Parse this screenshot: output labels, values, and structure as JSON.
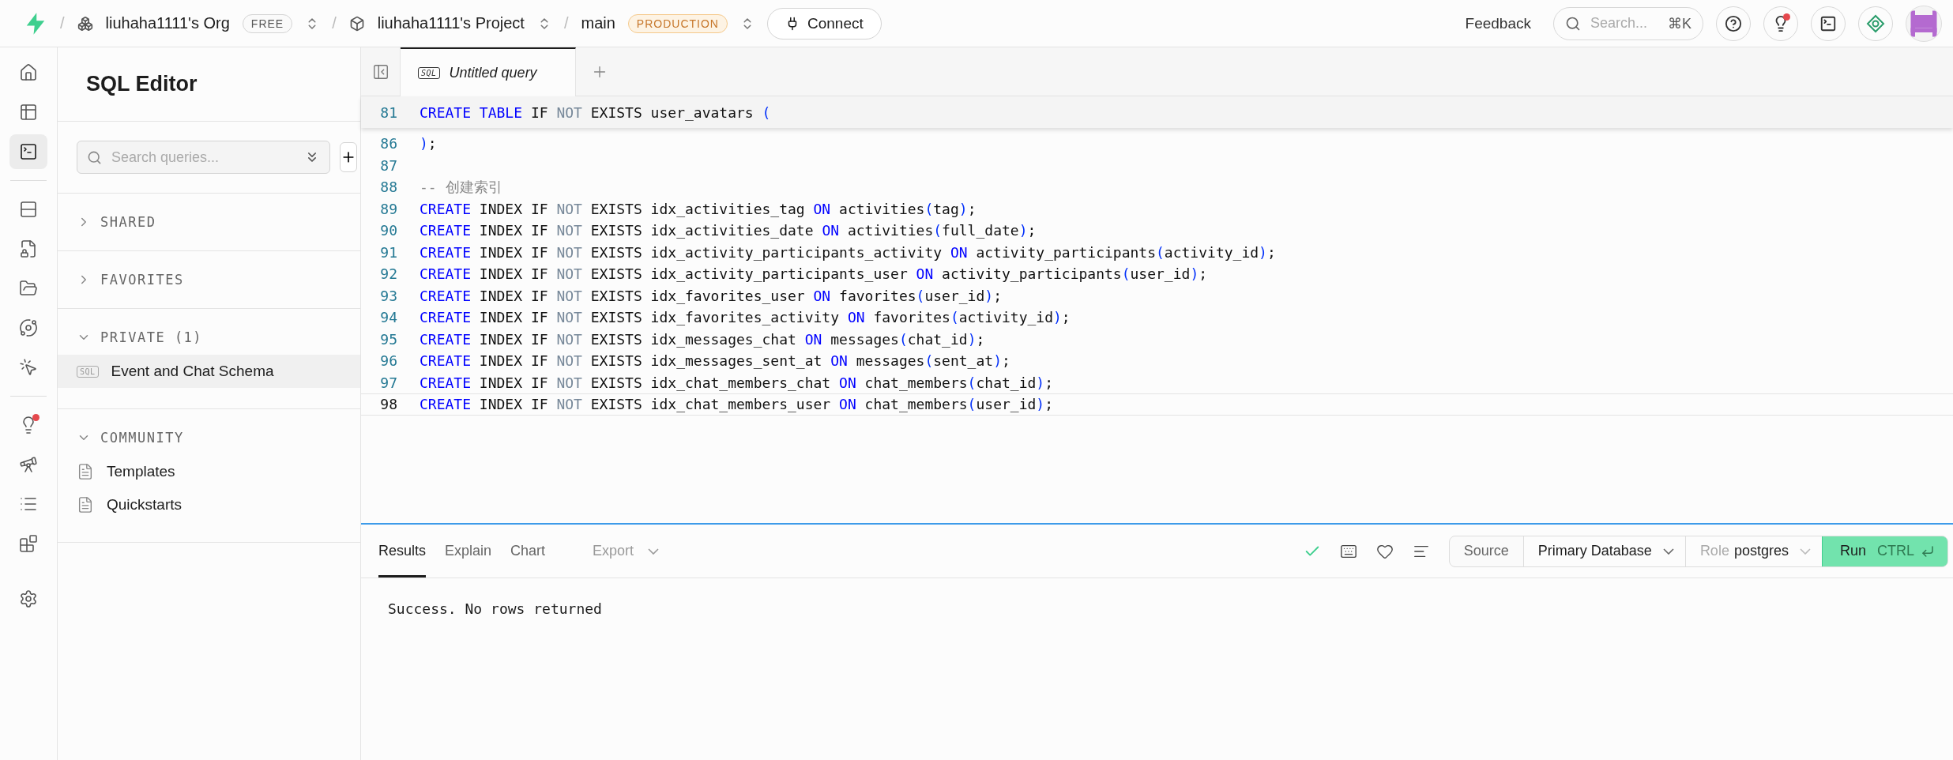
{
  "topbar": {
    "separators": [
      "/",
      "/",
      "/"
    ],
    "org": "liuhaha1111's Org",
    "org_plan": "FREE",
    "project": "liuhaha1111's Project",
    "branch": "main",
    "branch_env": "PRODUCTION",
    "connect": "Connect",
    "feedback": "Feedback",
    "search": {
      "placeholder": "Search...",
      "shortcut": "⌘K"
    },
    "tips_dot": true
  },
  "rail": [
    {
      "selected": false,
      "dot": false
    },
    {
      "selected": false,
      "dot": false
    },
    {
      "selected": true,
      "dot": false
    },
    {
      "selected": false,
      "dot": false
    },
    {
      "selected": false,
      "dot": false
    },
    {
      "selected": false,
      "dot": false
    },
    {
      "selected": false,
      "dot": false
    },
    {
      "selected": false,
      "dot": false
    },
    {
      "selected": false,
      "dot": true
    },
    {
      "selected": false,
      "dot": false
    },
    {
      "selected": false,
      "dot": false
    },
    {
      "selected": false,
      "dot": false
    },
    {
      "selected": false,
      "dot": false
    }
  ],
  "sidebar": {
    "title": "SQL Editor",
    "search": {
      "placeholder": "Search queries..."
    },
    "sections": [
      {
        "label": "SHARED",
        "expanded": false
      },
      {
        "label": "FAVORITES",
        "expanded": false
      },
      {
        "label": "PRIVATE (1)",
        "expanded": true,
        "items": [
          {
            "kind": "query",
            "badge": "SQL",
            "label": "Event and Chat Schema",
            "selected": true
          }
        ]
      },
      {
        "label": "COMMUNITY",
        "expanded": true,
        "items": [
          {
            "kind": "doc",
            "label": "Templates",
            "selected": false
          },
          {
            "kind": "doc",
            "label": "Quickstarts",
            "selected": false
          }
        ]
      }
    ]
  },
  "editor": {
    "tabs": [
      {
        "badge": "SQL",
        "label": "Untitled query",
        "selected": true
      }
    ],
    "sticky_line": {
      "number": "81",
      "tokens": [
        {
          "kind": "keyword",
          "text": "CREATE TABLE "
        },
        {
          "kind": "plain",
          "text": "IF "
        },
        {
          "kind": "muted",
          "text": "NOT "
        },
        {
          "kind": "plain",
          "text": "EXISTS user_avatars "
        },
        {
          "kind": "bracket",
          "text": "("
        }
      ]
    },
    "lines": [
      {
        "number": "86",
        "current": false,
        "tokens": [
          {
            "kind": "bracket",
            "text": ")"
          },
          {
            "kind": "plain",
            "text": ";"
          }
        ]
      },
      {
        "number": "87",
        "current": false
      },
      {
        "number": "88",
        "current": false,
        "tokens": [
          {
            "kind": "comment",
            "text": "-- 创建索引"
          }
        ]
      },
      {
        "number": "89",
        "current": false,
        "tokens": [
          {
            "kind": "keyword",
            "text": "CREATE "
          },
          {
            "kind": "plain",
            "text": "INDEX IF "
          },
          {
            "kind": "muted",
            "text": "NOT "
          },
          {
            "kind": "plain",
            "text": "EXISTS idx_activities_tag "
          },
          {
            "kind": "keyword",
            "text": "ON "
          },
          {
            "kind": "plain",
            "text": "activities"
          },
          {
            "kind": "bracket",
            "text": "("
          },
          {
            "kind": "plain",
            "text": "tag"
          },
          {
            "kind": "bracket",
            "text": ")"
          },
          {
            "kind": "plain",
            "text": ";"
          }
        ]
      },
      {
        "number": "90",
        "current": false,
        "tokens": [
          {
            "kind": "keyword",
            "text": "CREATE "
          },
          {
            "kind": "plain",
            "text": "INDEX IF "
          },
          {
            "kind": "muted",
            "text": "NOT "
          },
          {
            "kind": "plain",
            "text": "EXISTS idx_activities_date "
          },
          {
            "kind": "keyword",
            "text": "ON "
          },
          {
            "kind": "plain",
            "text": "activities"
          },
          {
            "kind": "bracket",
            "text": "("
          },
          {
            "kind": "plain",
            "text": "full_date"
          },
          {
            "kind": "bracket",
            "text": ")"
          },
          {
            "kind": "plain",
            "text": ";"
          }
        ]
      },
      {
        "number": "91",
        "current": false,
        "tokens": [
          {
            "kind": "keyword",
            "text": "CREATE "
          },
          {
            "kind": "plain",
            "text": "INDEX IF "
          },
          {
            "kind": "muted",
            "text": "NOT "
          },
          {
            "kind": "plain",
            "text": "EXISTS idx_activity_participants_activity "
          },
          {
            "kind": "keyword",
            "text": "ON "
          },
          {
            "kind": "plain",
            "text": "activity_participants"
          },
          {
            "kind": "bracket",
            "text": "("
          },
          {
            "kind": "plain",
            "text": "activity_id"
          },
          {
            "kind": "bracket",
            "text": ")"
          },
          {
            "kind": "plain",
            "text": ";"
          }
        ]
      },
      {
        "number": "92",
        "current": false,
        "tokens": [
          {
            "kind": "keyword",
            "text": "CREATE "
          },
          {
            "kind": "plain",
            "text": "INDEX IF "
          },
          {
            "kind": "muted",
            "text": "NOT "
          },
          {
            "kind": "plain",
            "text": "EXISTS idx_activity_participants_user "
          },
          {
            "kind": "keyword",
            "text": "ON "
          },
          {
            "kind": "plain",
            "text": "activity_participants"
          },
          {
            "kind": "bracket",
            "text": "("
          },
          {
            "kind": "plain",
            "text": "user_id"
          },
          {
            "kind": "bracket",
            "text": ")"
          },
          {
            "kind": "plain",
            "text": ";"
          }
        ]
      },
      {
        "number": "93",
        "current": false,
        "tokens": [
          {
            "kind": "keyword",
            "text": "CREATE "
          },
          {
            "kind": "plain",
            "text": "INDEX IF "
          },
          {
            "kind": "muted",
            "text": "NOT "
          },
          {
            "kind": "plain",
            "text": "EXISTS idx_favorites_user "
          },
          {
            "kind": "keyword",
            "text": "ON "
          },
          {
            "kind": "plain",
            "text": "favorites"
          },
          {
            "kind": "bracket",
            "text": "("
          },
          {
            "kind": "plain",
            "text": "user_id"
          },
          {
            "kind": "bracket",
            "text": ")"
          },
          {
            "kind": "plain",
            "text": ";"
          }
        ]
      },
      {
        "number": "94",
        "current": false,
        "tokens": [
          {
            "kind": "keyword",
            "text": "CREATE "
          },
          {
            "kind": "plain",
            "text": "INDEX IF "
          },
          {
            "kind": "muted",
            "text": "NOT "
          },
          {
            "kind": "plain",
            "text": "EXISTS idx_favorites_activity "
          },
          {
            "kind": "keyword",
            "text": "ON "
          },
          {
            "kind": "plain",
            "text": "favorites"
          },
          {
            "kind": "bracket",
            "text": "("
          },
          {
            "kind": "plain",
            "text": "activity_id"
          },
          {
            "kind": "bracket",
            "text": ")"
          },
          {
            "kind": "plain",
            "text": ";"
          }
        ]
      },
      {
        "number": "95",
        "current": false,
        "tokens": [
          {
            "kind": "keyword",
            "text": "CREATE "
          },
          {
            "kind": "plain",
            "text": "INDEX IF "
          },
          {
            "kind": "muted",
            "text": "NOT "
          },
          {
            "kind": "plain",
            "text": "EXISTS idx_messages_chat "
          },
          {
            "kind": "keyword",
            "text": "ON "
          },
          {
            "kind": "plain",
            "text": "messages"
          },
          {
            "kind": "bracket",
            "text": "("
          },
          {
            "kind": "plain",
            "text": "chat_id"
          },
          {
            "kind": "bracket",
            "text": ")"
          },
          {
            "kind": "plain",
            "text": ";"
          }
        ]
      },
      {
        "number": "96",
        "current": false,
        "tokens": [
          {
            "kind": "keyword",
            "text": "CREATE "
          },
          {
            "kind": "plain",
            "text": "INDEX IF "
          },
          {
            "kind": "muted",
            "text": "NOT "
          },
          {
            "kind": "plain",
            "text": "EXISTS idx_messages_sent_at "
          },
          {
            "kind": "keyword",
            "text": "ON "
          },
          {
            "kind": "plain",
            "text": "messages"
          },
          {
            "kind": "bracket",
            "text": "("
          },
          {
            "kind": "plain",
            "text": "sent_at"
          },
          {
            "kind": "bracket",
            "text": ")"
          },
          {
            "kind": "plain",
            "text": ";"
          }
        ]
      },
      {
        "number": "97",
        "current": false,
        "tokens": [
          {
            "kind": "keyword",
            "text": "CREATE "
          },
          {
            "kind": "plain",
            "text": "INDEX IF "
          },
          {
            "kind": "muted",
            "text": "NOT "
          },
          {
            "kind": "plain",
            "text": "EXISTS idx_chat_members_chat "
          },
          {
            "kind": "keyword",
            "text": "ON "
          },
          {
            "kind": "plain",
            "text": "chat_members"
          },
          {
            "kind": "bracket",
            "text": "("
          },
          {
            "kind": "plain",
            "text": "chat_id"
          },
          {
            "kind": "bracket",
            "text": ")"
          },
          {
            "kind": "plain",
            "text": ";"
          }
        ]
      },
      {
        "number": "98",
        "current": true,
        "tokens": [
          {
            "kind": "keyword",
            "text": "CREATE "
          },
          {
            "kind": "plain",
            "text": "INDEX IF "
          },
          {
            "kind": "muted",
            "text": "NOT "
          },
          {
            "kind": "plain",
            "text": "EXISTS idx_chat_members_user "
          },
          {
            "kind": "keyword",
            "text": "ON "
          },
          {
            "kind": "plain",
            "text": "chat_members"
          },
          {
            "kind": "bracket",
            "text": "("
          },
          {
            "kind": "plain",
            "text": "user_id"
          },
          {
            "kind": "bracket",
            "text": ")"
          },
          {
            "kind": "plain",
            "text": ";"
          }
        ]
      }
    ]
  },
  "results": {
    "tabs": [
      {
        "label": "Results",
        "selected": true
      },
      {
        "label": "Explain",
        "selected": false
      },
      {
        "label": "Chart",
        "selected": false
      }
    ],
    "export": {
      "label": "Export",
      "disabled": true
    },
    "source_label": "Source",
    "database": "Primary Database",
    "role_label": "Role",
    "role": "postgres",
    "run": {
      "label": "Run",
      "shortcut": "CTRL"
    },
    "message": "Success. No rows returned"
  }
}
